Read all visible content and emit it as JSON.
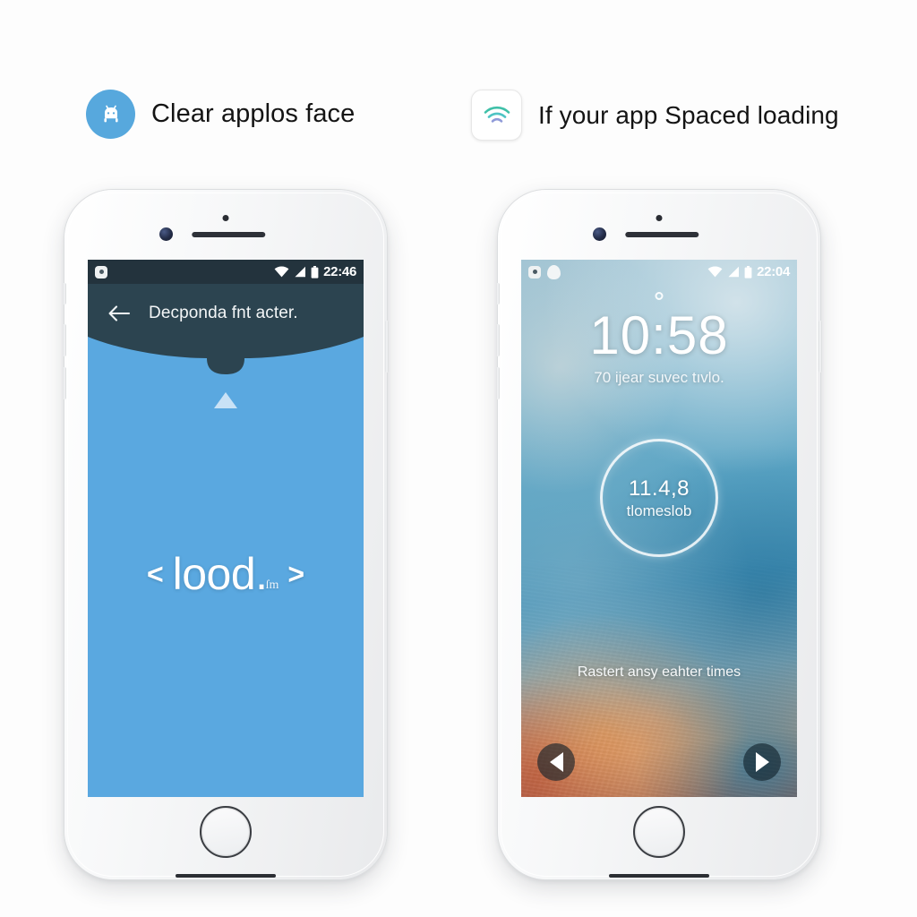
{
  "headings": {
    "left": {
      "icon": "car-android-icon",
      "text": "Clear applos face",
      "icon_bg": "#57a8dd"
    },
    "right": {
      "icon": "wifi-icon",
      "text": "If your app Spaced  loading",
      "icon_bg": "#ffffff"
    }
  },
  "left_phone": {
    "statusbar": {
      "left_icons": [
        "notification-badge-icon"
      ],
      "wifi_icon": "wifi-icon",
      "signal_icon": "signal-icon",
      "battery_icon": "battery-icon",
      "time": "22:46",
      "bg": "#23333d"
    },
    "appbar": {
      "back_icon": "back-arrow-icon",
      "title": "Decponda fnt acter.",
      "bg": "#2c4450"
    },
    "body": {
      "bg": "#5aa8e0",
      "arrow_icon": "up-triangle-icon",
      "code_open": "<",
      "code_word": "lood.",
      "code_close": ">",
      "code_sub": "ſm"
    }
  },
  "right_phone": {
    "statusbar": {
      "left_icons": [
        "notification-badge-icon",
        "shield-icon"
      ],
      "wifi_icon": "wifi-icon",
      "signal_icon": "signal-icon",
      "battery_icon": "battery-icon",
      "time": "22:04"
    },
    "lockscreen": {
      "dot_icon": "lock-dot-icon",
      "clock": "10:58",
      "subtitle": "70 ijear suvec tıvlo.",
      "ring": {
        "value": "11.4,8",
        "label": "tlomeslob"
      },
      "hint": "Rastert ansy eahter times",
      "buttons": {
        "left_icon": "previous-triangle-icon",
        "right_icon": "next-triangle-icon"
      }
    }
  }
}
